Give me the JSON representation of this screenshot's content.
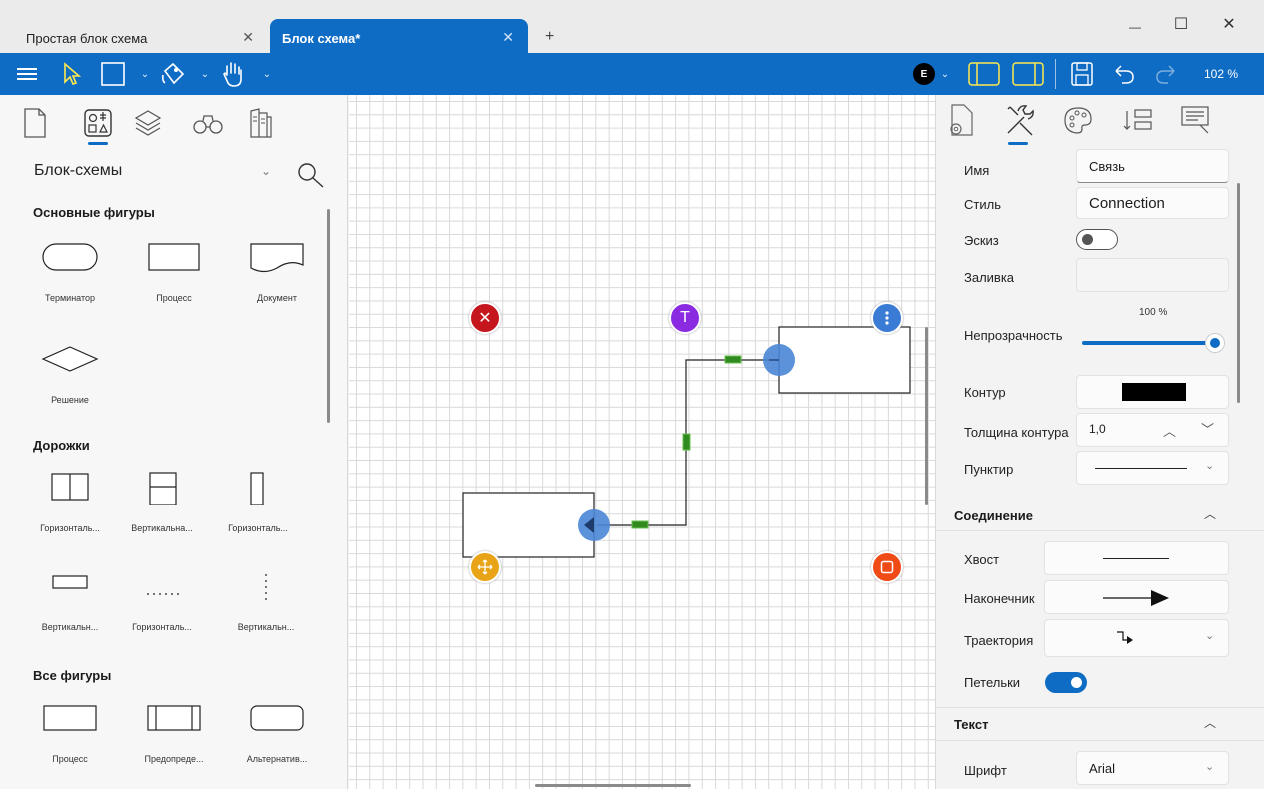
{
  "tabs": [
    {
      "label": "Простая блок схема",
      "active": false
    },
    {
      "label": "Блок схема*",
      "active": true
    }
  ],
  "new_tab_symbol": "+",
  "window_controls": {
    "minimize": "—",
    "maximize": "☐",
    "close": "✕"
  },
  "toolbar": {
    "tools": [
      "menu-icon",
      "pointer-icon",
      "rectangle-icon",
      "fill-bucket-icon",
      "hand-icon"
    ],
    "badge_letter": "E",
    "right_tools": [
      "panel-left-icon",
      "panel-right-icon",
      "save-icon",
      "undo-icon",
      "redo-icon"
    ],
    "zoom": "102 %"
  },
  "left_panel": {
    "tabs": [
      "page-icon",
      "shapes-icon",
      "layers-icon",
      "binoculars-icon",
      "library-icon"
    ],
    "category": "Блок-схемы",
    "sections": [
      {
        "title": "Основные фигуры",
        "items": [
          "Терминатор",
          "Процесс",
          "Документ",
          "Решение"
        ]
      },
      {
        "title": "Дорожки",
        "items": [
          "Горизонталь...",
          "Вертикальна...",
          "Горизонталь...",
          "Вертикальн...",
          "Горизонталь...",
          "Вертикальн..."
        ]
      },
      {
        "title": "Все фигуры",
        "items": [
          "Процесс",
          "Предопреде...",
          "Альтернатив..."
        ]
      }
    ]
  },
  "canvas": {
    "handles": {
      "delete": {
        "color": "#c4161c",
        "icon": "close-icon"
      },
      "text": {
        "color": "#8a2be2",
        "label": "T",
        "icon": "text-icon"
      },
      "more": {
        "color": "#3a7bd5",
        "icon": "more-vertical-icon"
      },
      "move": {
        "color": "#e8a317",
        "icon": "move-icon"
      },
      "style": {
        "color": "#f04a17",
        "icon": "square-icon"
      }
    }
  },
  "right_panel": {
    "tabs": [
      "shape-settings-icon",
      "tools-icon",
      "palette-icon",
      "arrange-icon",
      "notes-icon"
    ],
    "fields": {
      "name_label": "Имя",
      "name_value": "Связь",
      "style_label": "Стиль",
      "style_value": "Connection",
      "sketch_label": "Эскиз",
      "sketch_on": false,
      "fill_label": "Заливка",
      "opacity_label": "Непрозрачность",
      "opacity_value": "100 %",
      "opacity_level": 1.0,
      "outline_label": "Контур",
      "outline_color": "#000000",
      "outline_width_label": "Толщина контура",
      "outline_width_value": "1,0",
      "dash_label": "Пунктир"
    },
    "connection": {
      "header": "Соединение",
      "tail_label": "Хвост",
      "head_label": "Наконечник",
      "path_label": "Траектория",
      "loops_label": "Петельки",
      "loops_on": true
    },
    "text": {
      "header": "Текст",
      "font_label": "Шрифт",
      "font_value": "Arial"
    }
  },
  "colors": {
    "accent": "#0f6cc4",
    "connector_mid": "#2f8a1f"
  }
}
